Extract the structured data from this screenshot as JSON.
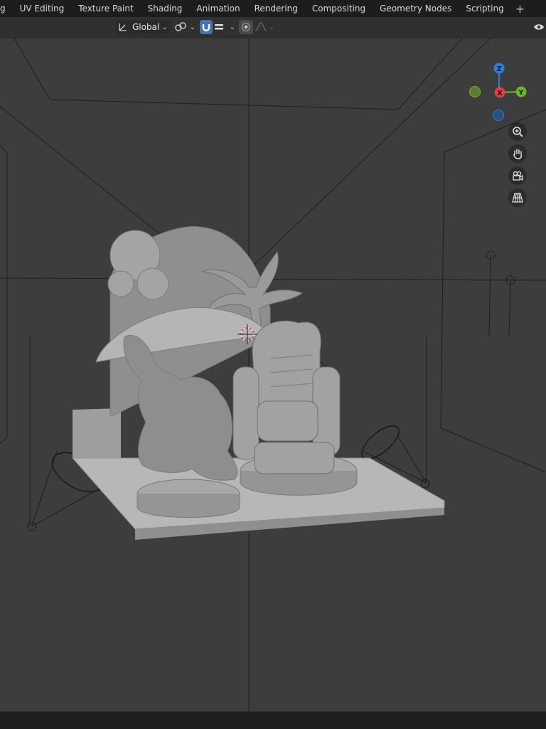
{
  "tabs": [
    "g",
    "UV Editing",
    "Texture Paint",
    "Shading",
    "Animation",
    "Rendering",
    "Compositing",
    "Geometry Nodes",
    "Scripting"
  ],
  "header": {
    "transform_orientation": "Global"
  },
  "gizmo": {
    "z": "Z",
    "x": "X",
    "y": "Y",
    "z_color": "#2f7fd6",
    "x_color": "#e23d50",
    "y_color": "#6fb52c"
  },
  "nav_icons": [
    "zoom-icon",
    "hand-pan-icon",
    "camera-view-icon",
    "perspective-grid-icon"
  ]
}
